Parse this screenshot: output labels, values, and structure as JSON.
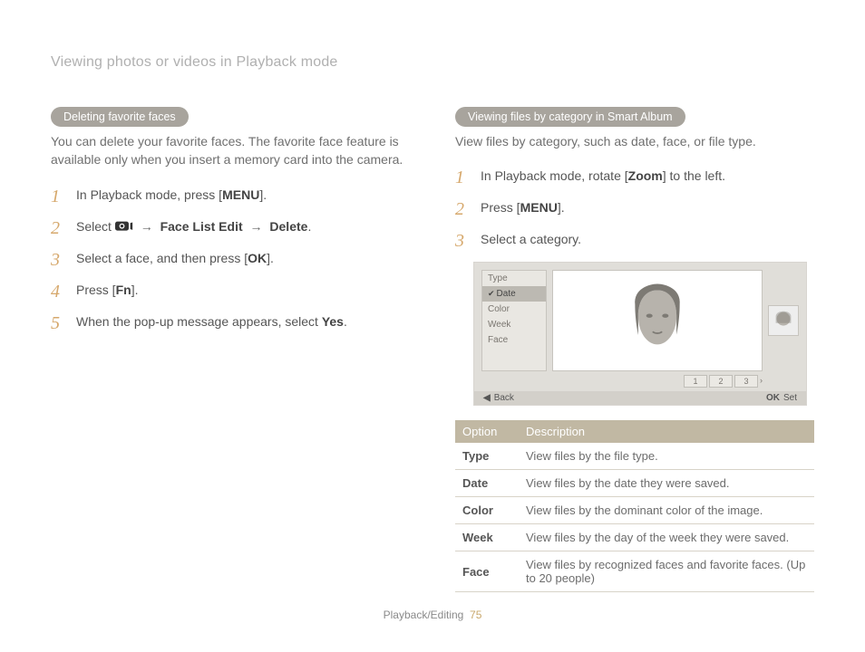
{
  "running_head": "Viewing photos or videos in Playback mode",
  "footer": {
    "section": "Playback/Editing",
    "page": "75"
  },
  "left": {
    "pill": "Deleting favorite faces",
    "intro": "You can delete your favorite faces. The favorite face feature is available only when you insert a memory card into the camera.",
    "steps": {
      "s1a": "In Playback mode, press [",
      "s1_btn": "MENU",
      "s1b": "].",
      "s2a": "Select ",
      "s2_chain1": "Face List Edit",
      "s2_chain2": "Delete",
      "s2b": ".",
      "s3a": "Select a face, and then press [",
      "s3_btn": "OK",
      "s3b": "].",
      "s4a": "Press [",
      "s4_btn": "Fn",
      "s4b": "].",
      "s5a": "When the pop-up message appears, select ",
      "s5_bold": "Yes",
      "s5b": "."
    }
  },
  "right": {
    "pill": "Viewing files by category in Smart Album",
    "intro": "View files by category, such as date, face, or file type.",
    "steps": {
      "s1a": "In Playback mode, rotate [",
      "s1_btn": "Zoom",
      "s1b": "] to the left.",
      "s2a": "Press [",
      "s2_btn": "MENU",
      "s2b": "].",
      "s3": "Select a category."
    },
    "screenshot": {
      "menu": {
        "i0": "Type",
        "i1": "Date",
        "i2": "Color",
        "i3": "Week",
        "i4": "Face"
      },
      "pager": {
        "p1": "1",
        "p2": "2",
        "p3": "3"
      },
      "bar": {
        "back_glyph": "◀",
        "back": "Back",
        "ok": "OK",
        "set": "Set"
      }
    },
    "table": {
      "h_option": "Option",
      "h_desc": "Description",
      "rows": {
        "r0": {
          "opt": "Type",
          "desc": "View files by the file type."
        },
        "r1": {
          "opt": "Date",
          "desc": "View files by the date they were saved."
        },
        "r2": {
          "opt": "Color",
          "desc": "View files by the dominant color of the image."
        },
        "r3": {
          "opt": "Week",
          "desc": "View files by the day of the week they were saved."
        },
        "r4": {
          "opt": "Face",
          "desc": "View files by recognized faces and favorite faces. (Up to 20 people)"
        }
      }
    }
  }
}
